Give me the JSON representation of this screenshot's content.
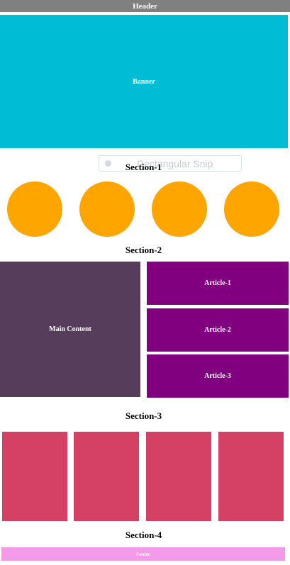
{
  "header": {
    "label": "Header"
  },
  "banner": {
    "label": "Banner"
  },
  "sections": {
    "section_1": {
      "title": "Section-1"
    },
    "section_2": {
      "title": "Section-2"
    },
    "section_3": {
      "title": "Section-3"
    },
    "section_4": {
      "title": "Section-4"
    }
  },
  "overlay": {
    "text": "Rectangular Snip"
  },
  "main": {
    "main_content_label": "Main Content",
    "articles": [
      {
        "label": "Article-1"
      },
      {
        "label": "Article-2"
      },
      {
        "label": "Article-3"
      }
    ]
  },
  "footer": {
    "label": "Footer"
  },
  "colors": {
    "header": "#808080",
    "banner": "#00bcd4",
    "circle": "#ffa500",
    "main_content": "#563d5c",
    "article": "#800080",
    "card": "#d54065",
    "footer": "#f39ae9"
  }
}
